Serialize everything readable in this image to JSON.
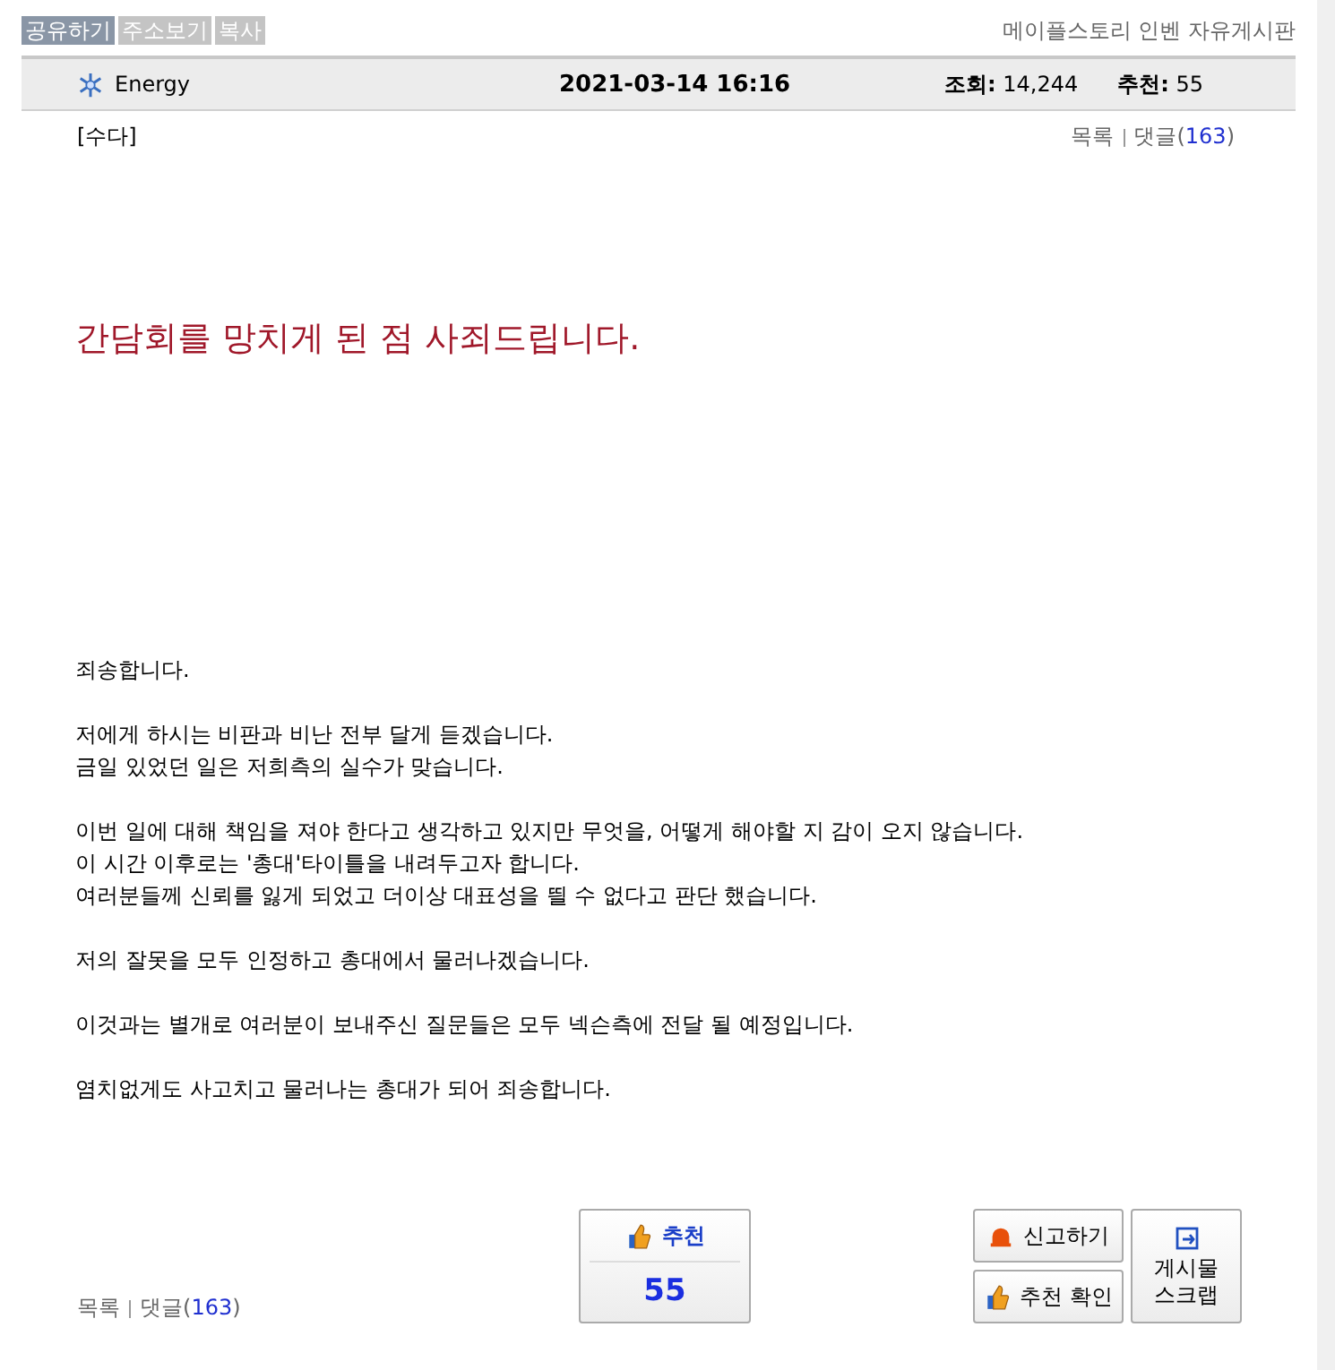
{
  "top_buttons": [
    {
      "label": "공유하기",
      "selected": true
    },
    {
      "label": "주소보기",
      "selected": false
    },
    {
      "label": "복사",
      "selected": false
    }
  ],
  "board_name": "메이플스토리 인벤 자유게시판",
  "post": {
    "author": "Energy",
    "datetime": "2021-03-14 16:16",
    "views_label": "조회:",
    "views": "14,244",
    "recommend_label": "추천:",
    "recommend": "55",
    "category": "[수다]",
    "list_link": "목록",
    "comments_label": "댓글(",
    "comments": "163",
    "comments_close": ")",
    "title": "간담회를 망치게 된 점 사죄드립니다.",
    "paragraphs": [
      [
        "죄송합니다."
      ],
      [
        "저에게 하시는 비판과 비난 전부 달게 듣겠습니다.",
        "금일 있었던 일은 저희측의 실수가 맞습니다."
      ],
      [
        "이번 일에 대해 책임을 져야 한다고 생각하고 있지만 무엇을, 어떻게 해야할 지 감이 오지 않습니다.",
        "이 시간 이후로는 '총대'타이틀을 내려두고자 합니다.",
        "여러분들께 신뢰를 잃게 되었고 더이상 대표성을 띌 수 없다고 판단 했습니다."
      ],
      [
        "저의 잘못을 모두 인정하고 총대에서 물러나겠습니다."
      ],
      [
        "이것과는 별개로 여러분이 보내주신 질문들은 모두 넥슨측에 전달 될 예정입니다."
      ],
      [
        "염치없게도 사고치고 물러나는 총대가 되어 죄송합니다."
      ]
    ]
  },
  "bottom": {
    "list_link": "목록",
    "comments_label": "댓글(",
    "comments": "163",
    "comments_close": ")",
    "recommend_button": {
      "label": "추천",
      "count": "55"
    },
    "report_button": "신고하기",
    "recommend_check_button": "추천 확인",
    "scrap_button": [
      "게시물",
      "스크랩"
    ]
  }
}
